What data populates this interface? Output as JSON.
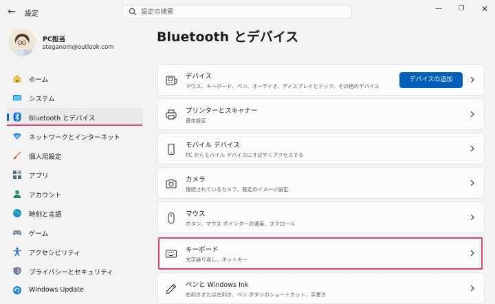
{
  "app": {
    "title": "設定",
    "back_icon": "back-arrow-icon"
  },
  "search": {
    "placeholder": "設定の検索"
  },
  "window_controls": {
    "minimize": "minimize-icon",
    "maximize": "maximize-icon",
    "close": "close-icon"
  },
  "profile": {
    "name": "PC担当",
    "email": "steganom@outlook.com"
  },
  "nav": {
    "items": [
      {
        "label": "ホーム",
        "icon": "home-icon"
      },
      {
        "label": "システム",
        "icon": "system-icon"
      },
      {
        "label": "Bluetooth とデバイス",
        "icon": "bluetooth-icon",
        "active": true
      },
      {
        "label": "ネットワークとインターネット",
        "icon": "network-icon"
      },
      {
        "label": "個人用設定",
        "icon": "personalization-icon"
      },
      {
        "label": "アプリ",
        "icon": "apps-icon"
      },
      {
        "label": "アカウント",
        "icon": "accounts-icon"
      },
      {
        "label": "時刻と言語",
        "icon": "time-language-icon"
      },
      {
        "label": "ゲーム",
        "icon": "gaming-icon"
      },
      {
        "label": "アクセシビリティ",
        "icon": "accessibility-icon"
      },
      {
        "label": "プライバシーとセキュリティ",
        "icon": "privacy-icon"
      },
      {
        "label": "Windows Update",
        "icon": "windows-update-icon"
      }
    ]
  },
  "page": {
    "title": "Bluetooth とデバイス"
  },
  "cards": [
    {
      "title": "デバイス",
      "subtitle": "マウス、キーボード、ペン、オーディオ、ディスプレイとドック、その他のデバイス",
      "icon": "devices-icon",
      "button": "デバイスの追加"
    },
    {
      "title": "プリンターとスキャナー",
      "subtitle": "基本設定",
      "icon": "printer-icon"
    },
    {
      "title": "モバイル デバイス",
      "subtitle": "PC からモバイル デバイスにすばやくアクセスする",
      "icon": "phone-icon"
    },
    {
      "title": "カメラ",
      "subtitle": "接続されているカメラ、既定のイメージ設定",
      "icon": "camera-icon"
    },
    {
      "title": "マウス",
      "subtitle": "ボタン、マウス ポインターの速度、スクロール",
      "icon": "mouse-icon"
    },
    {
      "title": "キーボード",
      "subtitle": "文字繰り返し、ホットキー",
      "icon": "keyboard-icon",
      "highlighted": true
    },
    {
      "title": "ペンと Windows Ink",
      "subtitle": "右利きまたは左利き、ペン ボタンのショートカット、手書き",
      "icon": "pen-icon"
    }
  ],
  "colors": {
    "accent": "#005fb8",
    "highlight": "#e0407c",
    "background": "#f3f3f3",
    "card": "#fbfbfb"
  }
}
